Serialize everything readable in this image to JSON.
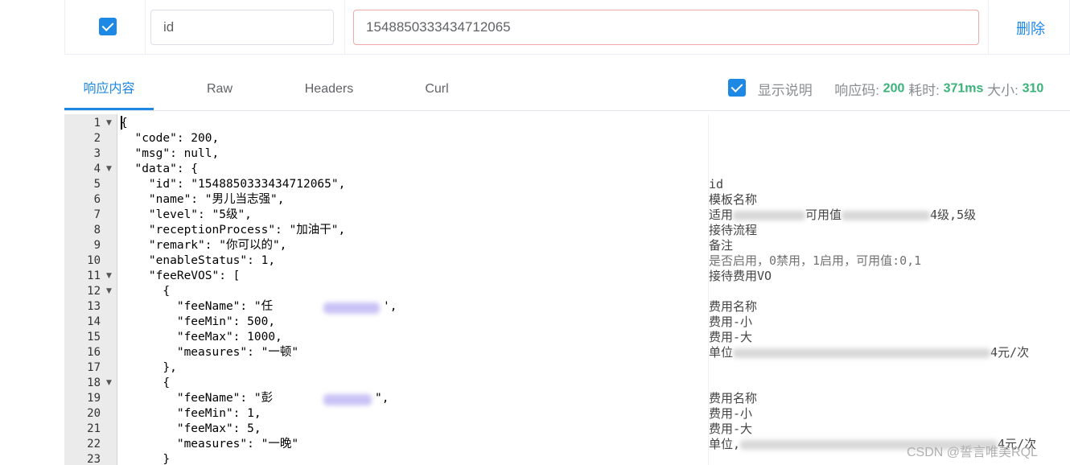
{
  "param_row": {
    "key": "id",
    "value": "1548850333434712065",
    "delete_label": "删除"
  },
  "tabs": [
    {
      "label": "响应内容",
      "active": true
    },
    {
      "label": "Raw",
      "active": false
    },
    {
      "label": "Headers",
      "active": false
    },
    {
      "label": "Curl",
      "active": false
    }
  ],
  "status": {
    "show_desc_label": "显示说明",
    "code_label": "响应码:",
    "code_value": "200",
    "time_label": "耗时:",
    "time_value": "371ms",
    "size_label": "大小:",
    "size_value": "310"
  },
  "editor": {
    "line_numbers": [
      "1",
      "2",
      "3",
      "4",
      "5",
      "6",
      "7",
      "8",
      "9",
      "10",
      "11",
      "12",
      "13",
      "14",
      "15",
      "16",
      "17",
      "18",
      "19",
      "20",
      "21",
      "22",
      "23"
    ],
    "fold_lines": [
      "1",
      "4",
      "11",
      "12",
      "18"
    ],
    "lines": [
      "{",
      "  \"code\": 200,",
      "  \"msg\": null,",
      "  \"data\": {",
      "    \"id\": \"1548850333434712065\",",
      "    \"name\": \"男儿当志强\",",
      "    \"level\": \"5级\",",
      "    \"receptionProcess\": \"加油干\",",
      "    \"remark\": \"你可以的\",",
      "    \"enableStatus\": 1,",
      "    \"feeReVOS\": [",
      "      {",
      "        \"feeName\": \"任",
      "        \"feeMin\": 500,",
      "        \"feeMax\": 1000,",
      "        \"measures\": \"一顿\"",
      "      },",
      "      {",
      "        \"feeName\": \"彭",
      "        \"feeMin\": 1,",
      "        \"feeMax\": 5,",
      "        \"measures\": \"一晚\"",
      "      }"
    ]
  },
  "descriptions": {
    "line5": "id",
    "line6": "模板名称",
    "line7_a": "适用",
    "line7_b": "可用值",
    "line7_c": "4级,5级",
    "line8": "接待流程",
    "line9": "备注",
    "line10_a": "是否启用，0禁用，1启用，可用值:0,1",
    "line11": "接待费用VO",
    "line13": "费用名称",
    "line14": "费用-小",
    "line15": "费用-大",
    "line16_a": "单位",
    "line16_b": "4元/次",
    "line19": "费用名称",
    "line20": "费用-小",
    "line21": "费用-大",
    "line22_a": "单位,",
    "line22_b": "4元/次"
  },
  "watermark": "CSDN @誓言唯美RQL"
}
